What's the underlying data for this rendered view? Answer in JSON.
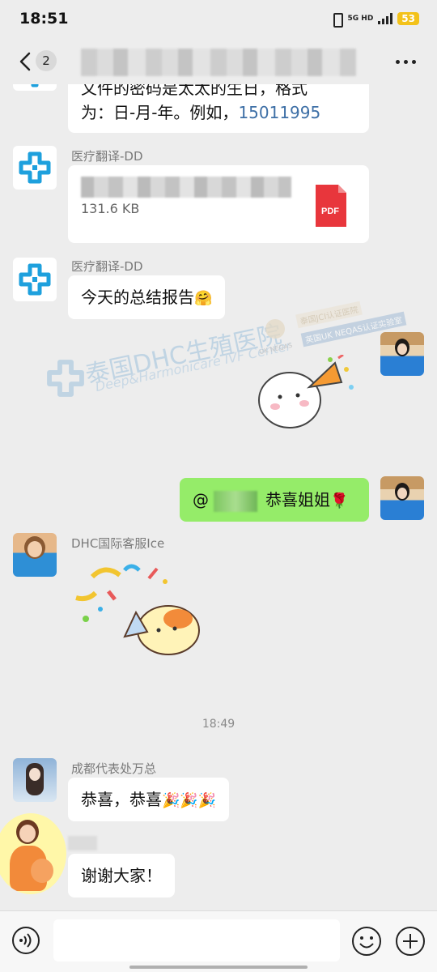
{
  "status_bar": {
    "time": "18:51",
    "network": "5G HD",
    "battery": "53"
  },
  "nav": {
    "unread_count": "2"
  },
  "messages": {
    "m1_text_line1": "文件的密码是太太的生日，格式",
    "m1_text_line2_prefix": "为：日-月-年。例如，",
    "m1_text_line2_number": "15011995",
    "m2_sender": "医疗翻译-DD",
    "m2_file_size": "131.6 KB",
    "m2_file_type": "PDF",
    "m3_sender": "医疗翻译-DD",
    "m3_text": "今天的总结报告",
    "m3_emoji": "🤗",
    "m5_at": "@",
    "m5_text": "恭喜姐姐",
    "m5_emoji": "🌹",
    "m6_sender": "DHC国际客服Ice",
    "timestamp": "18:49",
    "m8_sender": "成都代表处万总",
    "m8_text": "恭喜，恭喜",
    "m8_emoji": "🎉🎉🎉",
    "m9_text": "谢谢大家！"
  },
  "watermark": {
    "title": "泰国DHC生殖医院",
    "subtitle": "Deep&Harmonicare IVF Center",
    "badge1": "泰国JCI认证医院",
    "badge2": "英国UK NEQAS认证实验室",
    "neqas": "UK NEQAS"
  },
  "colors": {
    "accent_green": "#95ec69",
    "link_blue": "#3d6fa6",
    "logo_blue": "#1ea0dd",
    "bg": "#ededed"
  },
  "icons": [
    "back-icon",
    "more-icon",
    "pdf-icon",
    "voice-icon",
    "emoji-icon",
    "plus-icon"
  ]
}
